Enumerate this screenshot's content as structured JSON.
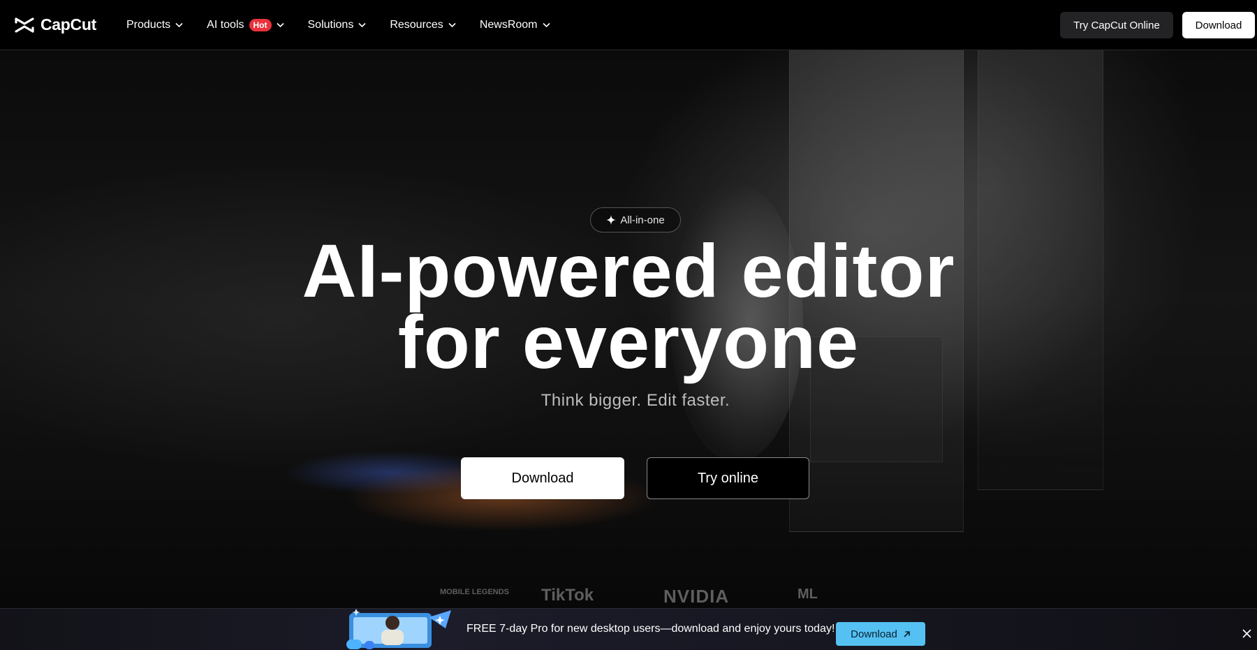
{
  "header": {
    "logo_text": "CapCut",
    "nav": [
      {
        "label": "Products"
      },
      {
        "label": "AI tools",
        "badge": "Hot"
      },
      {
        "label": "Solutions"
      },
      {
        "label": "Resources"
      },
      {
        "label": "NewsRoom"
      }
    ],
    "try_online_label": "Try CapCut Online",
    "download_label": "Download"
  },
  "hero": {
    "badge": "All-in-one",
    "title_line1": "AI-powered editor",
    "title_line2": "for everyone",
    "subtitle": "Think bigger. Edit faster.",
    "download_label": "Download",
    "try_label": "Try online",
    "partner_logos": [
      "MOBILE LEGENDS",
      "TikTok",
      "NVIDIA",
      "ML"
    ]
  },
  "promo": {
    "text": "FREE 7-day Pro for new desktop users—download and enjoy yours today!",
    "download_label": "Download"
  },
  "colors": {
    "hot_badge": "#e8323c",
    "promo_button": "#55c1f2"
  }
}
